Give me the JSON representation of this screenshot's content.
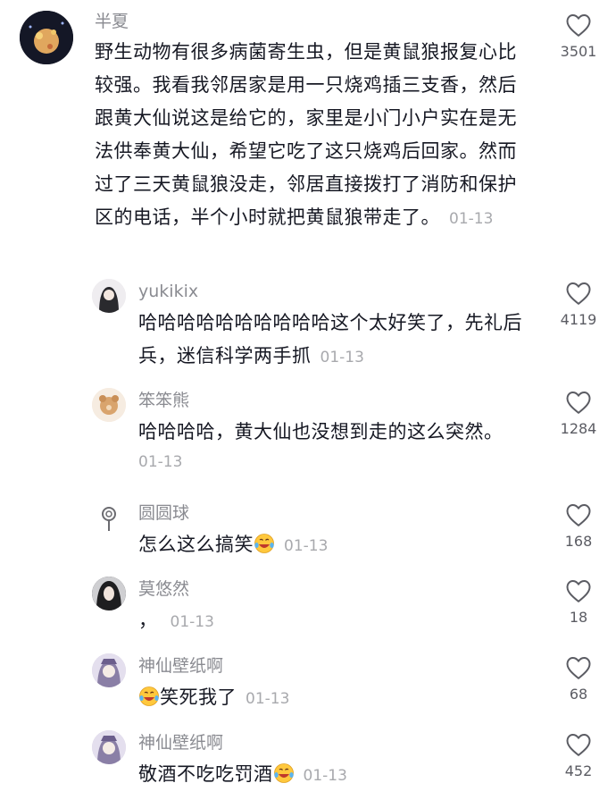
{
  "comments": [
    {
      "name": "半夏",
      "text": "野生动物有很多病菌寄生虫，但是黄鼠狼报复心比较强。我看我邻居家是用一只烧鸡插三支香，然后跟黄大仙说这是给它的，家里是小门小户实在是无法供奉黄大仙，希望它吃了这只烧鸡后回家。然而过了三天黄鼠狼没走，邻居直接拨打了消防和保护区的电话，半个小时就把黄鼠狼带走了。",
      "time": "01-13",
      "likes": "3501",
      "avatar_icon": "night-city-avatar"
    },
    {
      "name": "yukikix",
      "text": "哈哈哈哈哈哈哈哈哈哈这个太好笑了，先礼后兵，迷信科学两手抓",
      "time": "01-13",
      "likes": "4119",
      "avatar_icon": "anime-girl-avatar"
    },
    {
      "name": "笨笨熊",
      "text": "哈哈哈哈，黄大仙也没想到走的这么突然。",
      "time": "01-13",
      "likes": "1284",
      "avatar_icon": "bear-avatar"
    },
    {
      "name": "圆圆球",
      "text": "怎么这么搞笑",
      "time": "01-13",
      "likes": "168",
      "avatar_icon": "lollipop-avatar"
    },
    {
      "name": "莫悠然",
      "text": "，",
      "time": "01-13",
      "likes": "18",
      "avatar_icon": "girl-portrait-avatar"
    },
    {
      "name": "神仙壁纸啊",
      "text": "笑死我了",
      "time": "01-13",
      "likes": "68",
      "avatar_icon": "anime-character-avatar"
    },
    {
      "name": "神仙壁纸啊",
      "text": "敬酒不吃吃罚酒",
      "time": "01-13",
      "likes": "452",
      "avatar_icon": "anime-character-avatar"
    }
  ],
  "icons": {
    "like": "heart-outline-icon",
    "emoji": "laugh-cry-emoji"
  },
  "colors": {
    "text": "#161823",
    "meta": "#a8a9ad",
    "name": "#8a8b91"
  }
}
